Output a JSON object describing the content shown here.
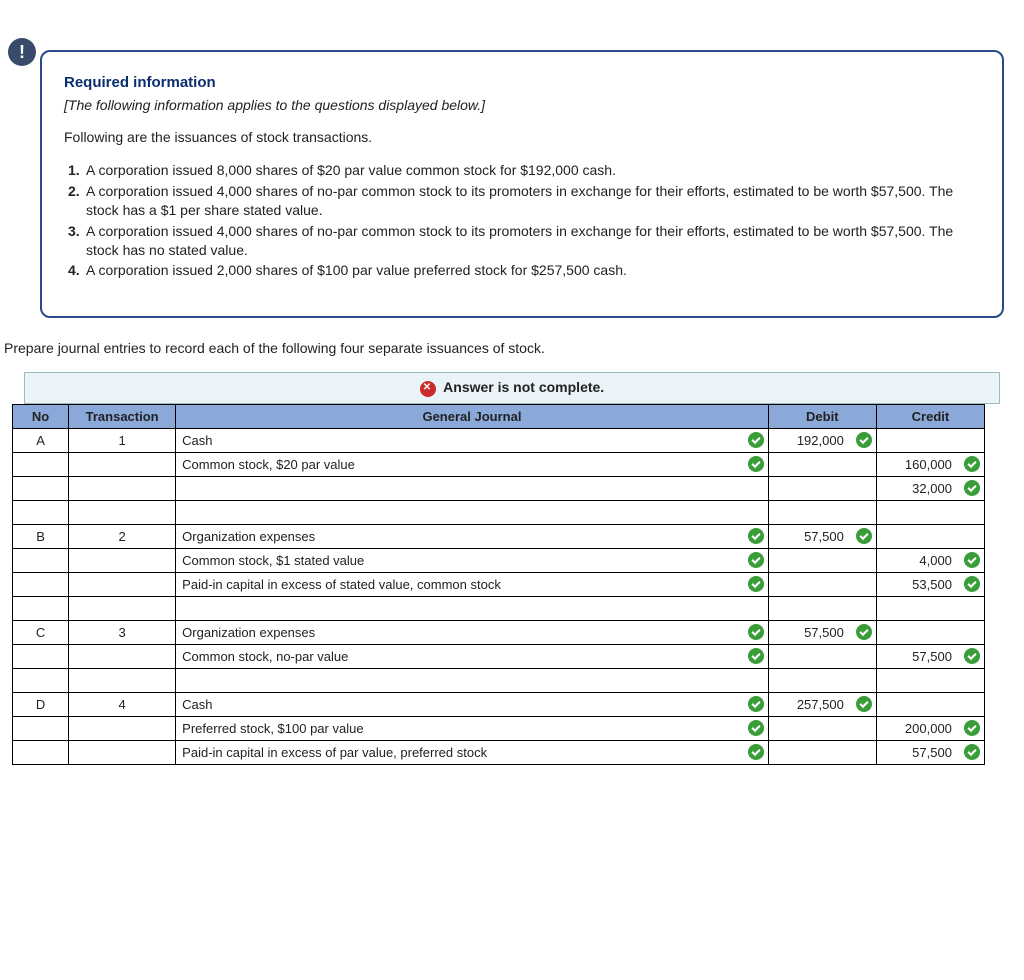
{
  "badge": "!",
  "info": {
    "title": "Required information",
    "subtitle": "[The following information applies to the questions displayed below.]",
    "intro": "Following are the issuances of stock transactions.",
    "items": [
      "A corporation issued 8,000 shares of $20 par value common stock for $192,000 cash.",
      "A corporation issued 4,000 shares of no-par common stock to its promoters in exchange for their efforts, estimated to be worth $57,500. The stock has a $1 per share stated value.",
      "A corporation issued 4,000 shares of no-par common stock to its promoters in exchange for their efforts, estimated to be worth $57,500. The stock has no stated value.",
      "A corporation issued 2,000 shares of $100 par value preferred stock for $257,500 cash."
    ]
  },
  "prepare": "Prepare journal entries to record each of the following four separate issuances of stock.",
  "answer_bar": "Answer is not complete.",
  "headers": {
    "no": "No",
    "txn": "Transaction",
    "gj": "General Journal",
    "debit": "Debit",
    "credit": "Credit"
  },
  "rows": {
    "a": {
      "no": "A",
      "txn": "1",
      "acct": "Cash",
      "debit": "192,000"
    },
    "a2": {
      "acct": "Common stock, $20 par value",
      "credit": "160,000"
    },
    "a3": {
      "credit": "32,000"
    },
    "b": {
      "no": "B",
      "txn": "2",
      "acct": "Organization expenses",
      "debit": "57,500"
    },
    "b2": {
      "acct": "Common stock, $1 stated value",
      "credit": "4,000"
    },
    "b3": {
      "acct": "Paid-in capital in excess of stated value, common stock",
      "credit": "53,500"
    },
    "c": {
      "no": "C",
      "txn": "3",
      "acct": "Organization expenses",
      "debit": "57,500"
    },
    "c2": {
      "acct": "Common stock, no-par value",
      "credit": "57,500"
    },
    "d": {
      "no": "D",
      "txn": "4",
      "acct": "Cash",
      "debit": "257,500"
    },
    "d2": {
      "acct": "Preferred stock, $100 par value",
      "credit": "200,000"
    },
    "d3": {
      "acct": "Paid-in capital in excess of par value, preferred stock",
      "credit": "57,500"
    }
  }
}
